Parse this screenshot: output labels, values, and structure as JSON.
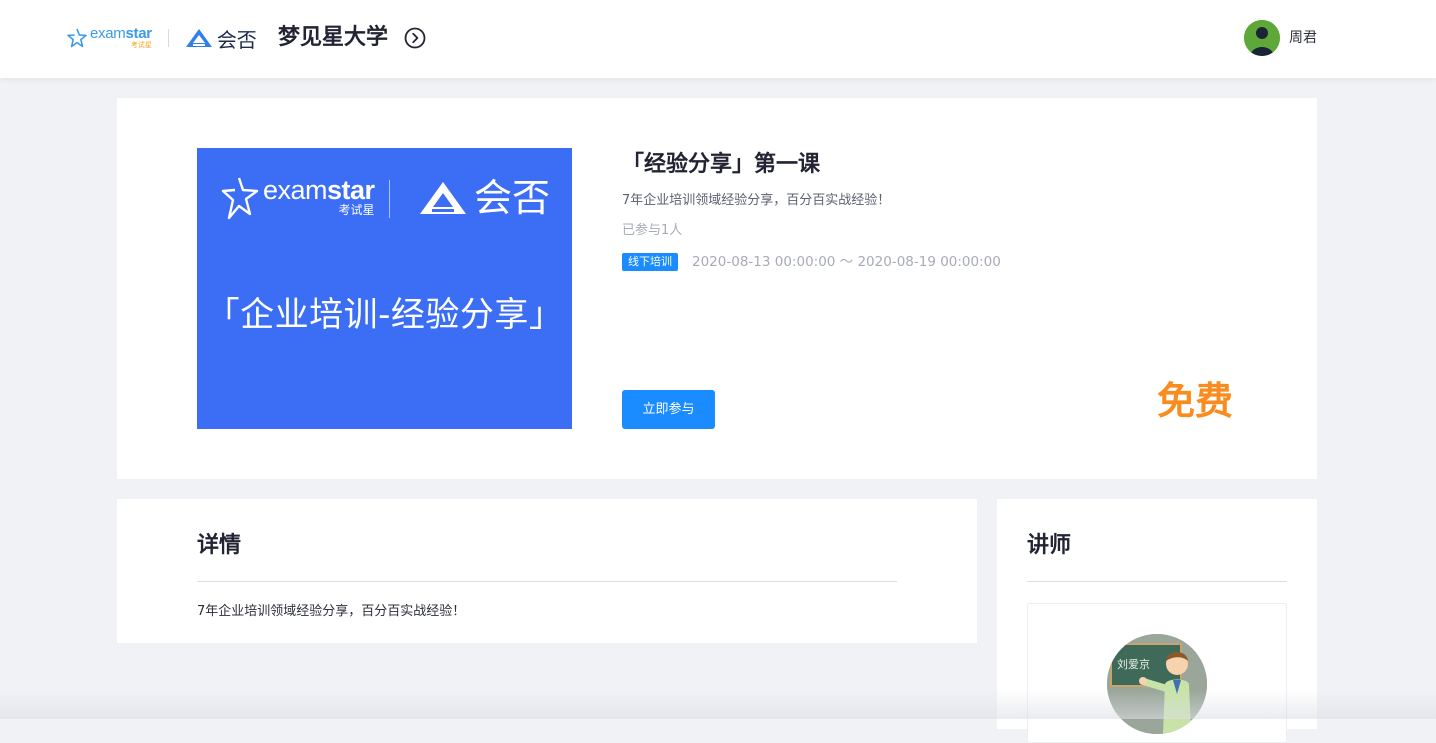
{
  "header": {
    "examstar_word_1": "exam",
    "examstar_word_2": "star",
    "examstar_sub": "考试星",
    "huifou_text": "会否",
    "site_title": "梦见星大学",
    "user_name": "周君"
  },
  "course": {
    "cover_es_word_1": "exam",
    "cover_es_word_2": "star",
    "cover_es_sub": "考试星",
    "cover_hf_text": "会否",
    "cover_title": "「企业培训-经验分享」",
    "title": "「经验分享」第一课",
    "description": "7年企业培训领域经验分享，百分百实战经验！",
    "joined": "已参与1人",
    "tag": "线下培训",
    "time_range": "2020-08-13 00:00:00 ～ 2020-08-19 00:00:00",
    "join_button": "立即参与",
    "price": "免费"
  },
  "detail": {
    "heading": "详情",
    "text": "7年企业培训领域经验分享，百分百实战经验！"
  },
  "teacher": {
    "heading": "讲师",
    "board_text": "刘爱京"
  },
  "colors": {
    "accent": "#1b8cff",
    "cover_bg": "#3b6ef5",
    "price": "#f98c1e",
    "page_bg": "#f0f2f6"
  },
  "icons": [
    "examstar-logo-icon",
    "huifou-logo-icon",
    "circle-chevron-right-icon",
    "user-avatar",
    "teacher-avatar"
  ]
}
